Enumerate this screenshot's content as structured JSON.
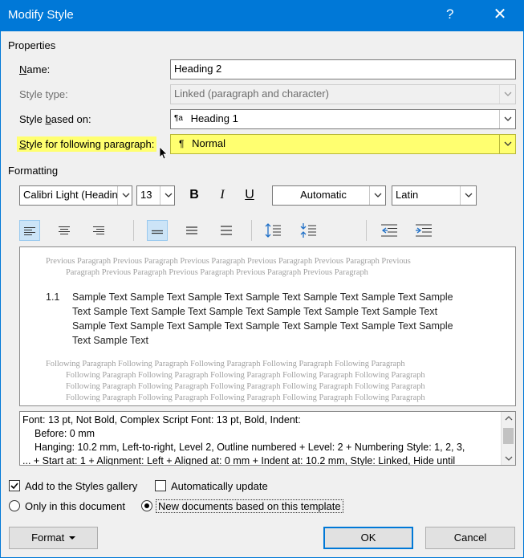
{
  "window": {
    "title": "Modify Style",
    "help_glyph": "?",
    "close_glyph": "✕"
  },
  "properties": {
    "section_label": "Properties",
    "name_label_first": "N",
    "name_label_rest": "ame:",
    "name_value": "Heading 2",
    "style_type_label": "Style type:",
    "style_type_value": "Linked (paragraph and character)",
    "based_on_label_a": "Style ",
    "based_on_label_u": "b",
    "based_on_label_b": "ased on:",
    "based_on_icon": "¶a",
    "based_on_value": "Heading 1",
    "following_label_first": "S",
    "following_label_rest": "tyle for following paragraph:",
    "following_icon": "¶",
    "following_value": "Normal"
  },
  "formatting": {
    "section_label": "Formatting",
    "font_value": "Calibri Light (Headin",
    "size_value": "13",
    "bold": "B",
    "italic": "I",
    "underline": "U",
    "color_value": "Automatic",
    "script_value": "Latin"
  },
  "preview": {
    "prev_line1": "Previous Paragraph Previous Paragraph Previous Paragraph Previous Paragraph Previous Paragraph Previous",
    "prev_line2": "Paragraph Previous Paragraph Previous Paragraph Previous Paragraph Previous Paragraph",
    "number": "1.1",
    "sample_line1": "Sample Text Sample Text Sample Text Sample Text Sample Text Sample Text Sample",
    "sample_line2": "Text Sample Text Sample Text Sample Text Sample Text Sample Text Sample Text",
    "sample_line3": "Sample Text Sample Text Sample Text Sample Text Sample Text Sample Text Sample",
    "sample_line4": "Text Sample Text",
    "follow_line1": "Following Paragraph Following Paragraph Following Paragraph Following Paragraph Following Paragraph",
    "follow_line2": "Following Paragraph Following Paragraph Following Paragraph Following Paragraph Following Paragraph",
    "follow_line3": "Following Paragraph Following Paragraph Following Paragraph Following Paragraph Following Paragraph",
    "follow_line4": "Following Paragraph Following Paragraph Following Paragraph Following Paragraph Following Paragraph"
  },
  "description": {
    "line1": "Font: 13 pt, Not Bold, Complex Script Font: 13 pt, Bold, Indent:",
    "line2": "Before:  0 mm",
    "line3": "Hanging:  10.2 mm, Left-to-right, Level 2, Outline numbered + Level: 2 + Numbering Style: 1, 2, 3,",
    "line4": "... + Start at: 1 + Alignment: Left + Aligned at:  0 mm + Indent at:  10.2 mm, Style: Linked, Hide until"
  },
  "options": {
    "add_gallery_label": "Add to the Styles gallery",
    "add_gallery_checked": true,
    "auto_update_label": "Automatically update",
    "auto_update_checked": false,
    "only_doc_label": "Only in this document",
    "new_docs_label": "New documents based on this template",
    "selected_scope": "new_docs"
  },
  "buttons": {
    "format": "Format",
    "ok": "OK",
    "cancel": "Cancel"
  },
  "colors": {
    "titlebar": "#0078d7",
    "highlight": "#ffff70",
    "active_button": "#cce4f7"
  }
}
